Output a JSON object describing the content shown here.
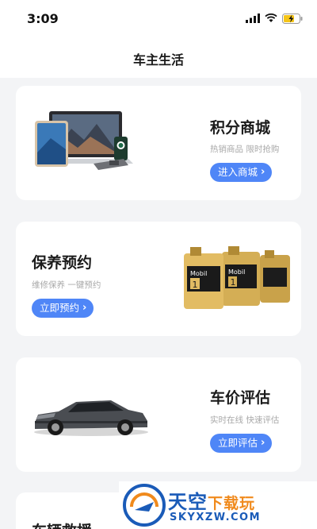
{
  "status_bar": {
    "time": "3:09"
  },
  "nav": {
    "title": "车主生活"
  },
  "cards": [
    {
      "title": "积分商城",
      "subtitle": "热销商品  限时抢购",
      "button": "进入商城"
    },
    {
      "title": "保养预约",
      "subtitle": "维修保养  一键预约",
      "button": "立即预约"
    },
    {
      "title": "车价评估",
      "subtitle": "实时在线  快速评估",
      "button": "立即评估"
    },
    {
      "title": "车辆救援"
    }
  ],
  "products": {
    "oil_brand": "Mobil",
    "oil_grade": "1"
  },
  "watermark": {
    "main": "天空",
    "accent": "下载玩",
    "url": "SKYXZW.COM"
  },
  "colors": {
    "accent": "#4f86f7",
    "background": "#f3f4f6",
    "card": "#ffffff"
  }
}
